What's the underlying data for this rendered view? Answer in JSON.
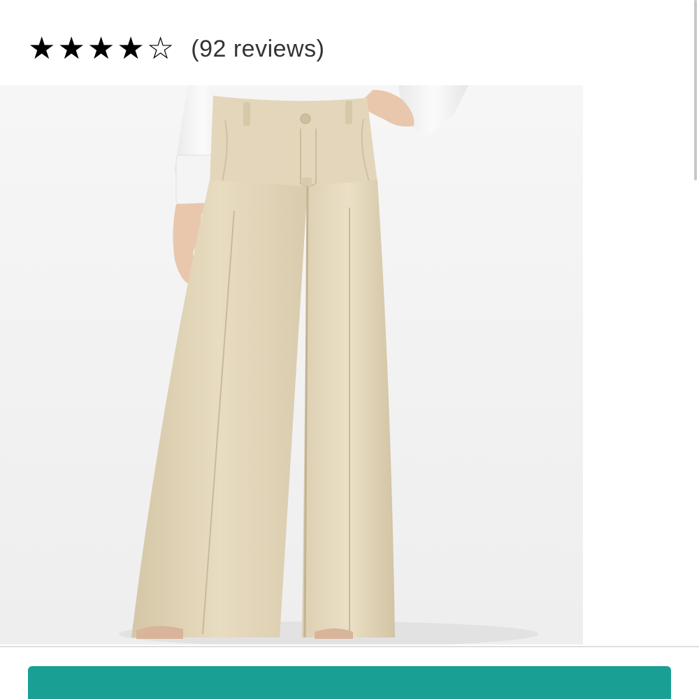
{
  "rating": {
    "value": 4.5,
    "max": 5,
    "stars": [
      "★",
      "★",
      "★",
      "★",
      "☆"
    ],
    "reviews_text": "(92 reviews)"
  },
  "product_image": {
    "subject": "product-photo-wide-leg-trousers"
  },
  "colors": {
    "star": "#000000",
    "cta_button": "#1a9f95",
    "image_background": "#f3f3f3",
    "trousers": "#e3d6ba"
  }
}
